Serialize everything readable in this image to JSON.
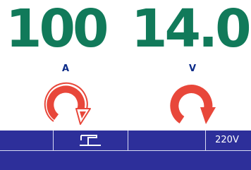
{
  "current": {
    "value": "100",
    "unit": "A",
    "knob_icon": "rotate-knob-icon"
  },
  "voltage": {
    "value": "14.0",
    "unit": "V",
    "knob_icon": "rotate-knob-icon"
  },
  "status_bar": {
    "process_icon": "welding-torch-icon",
    "supply_voltage": "220V"
  },
  "colors": {
    "value_green": "#117a5a",
    "unit_blue": "#0a2a88",
    "knob_red": "#e8473a",
    "bar_blue": "#2d2f9a"
  }
}
